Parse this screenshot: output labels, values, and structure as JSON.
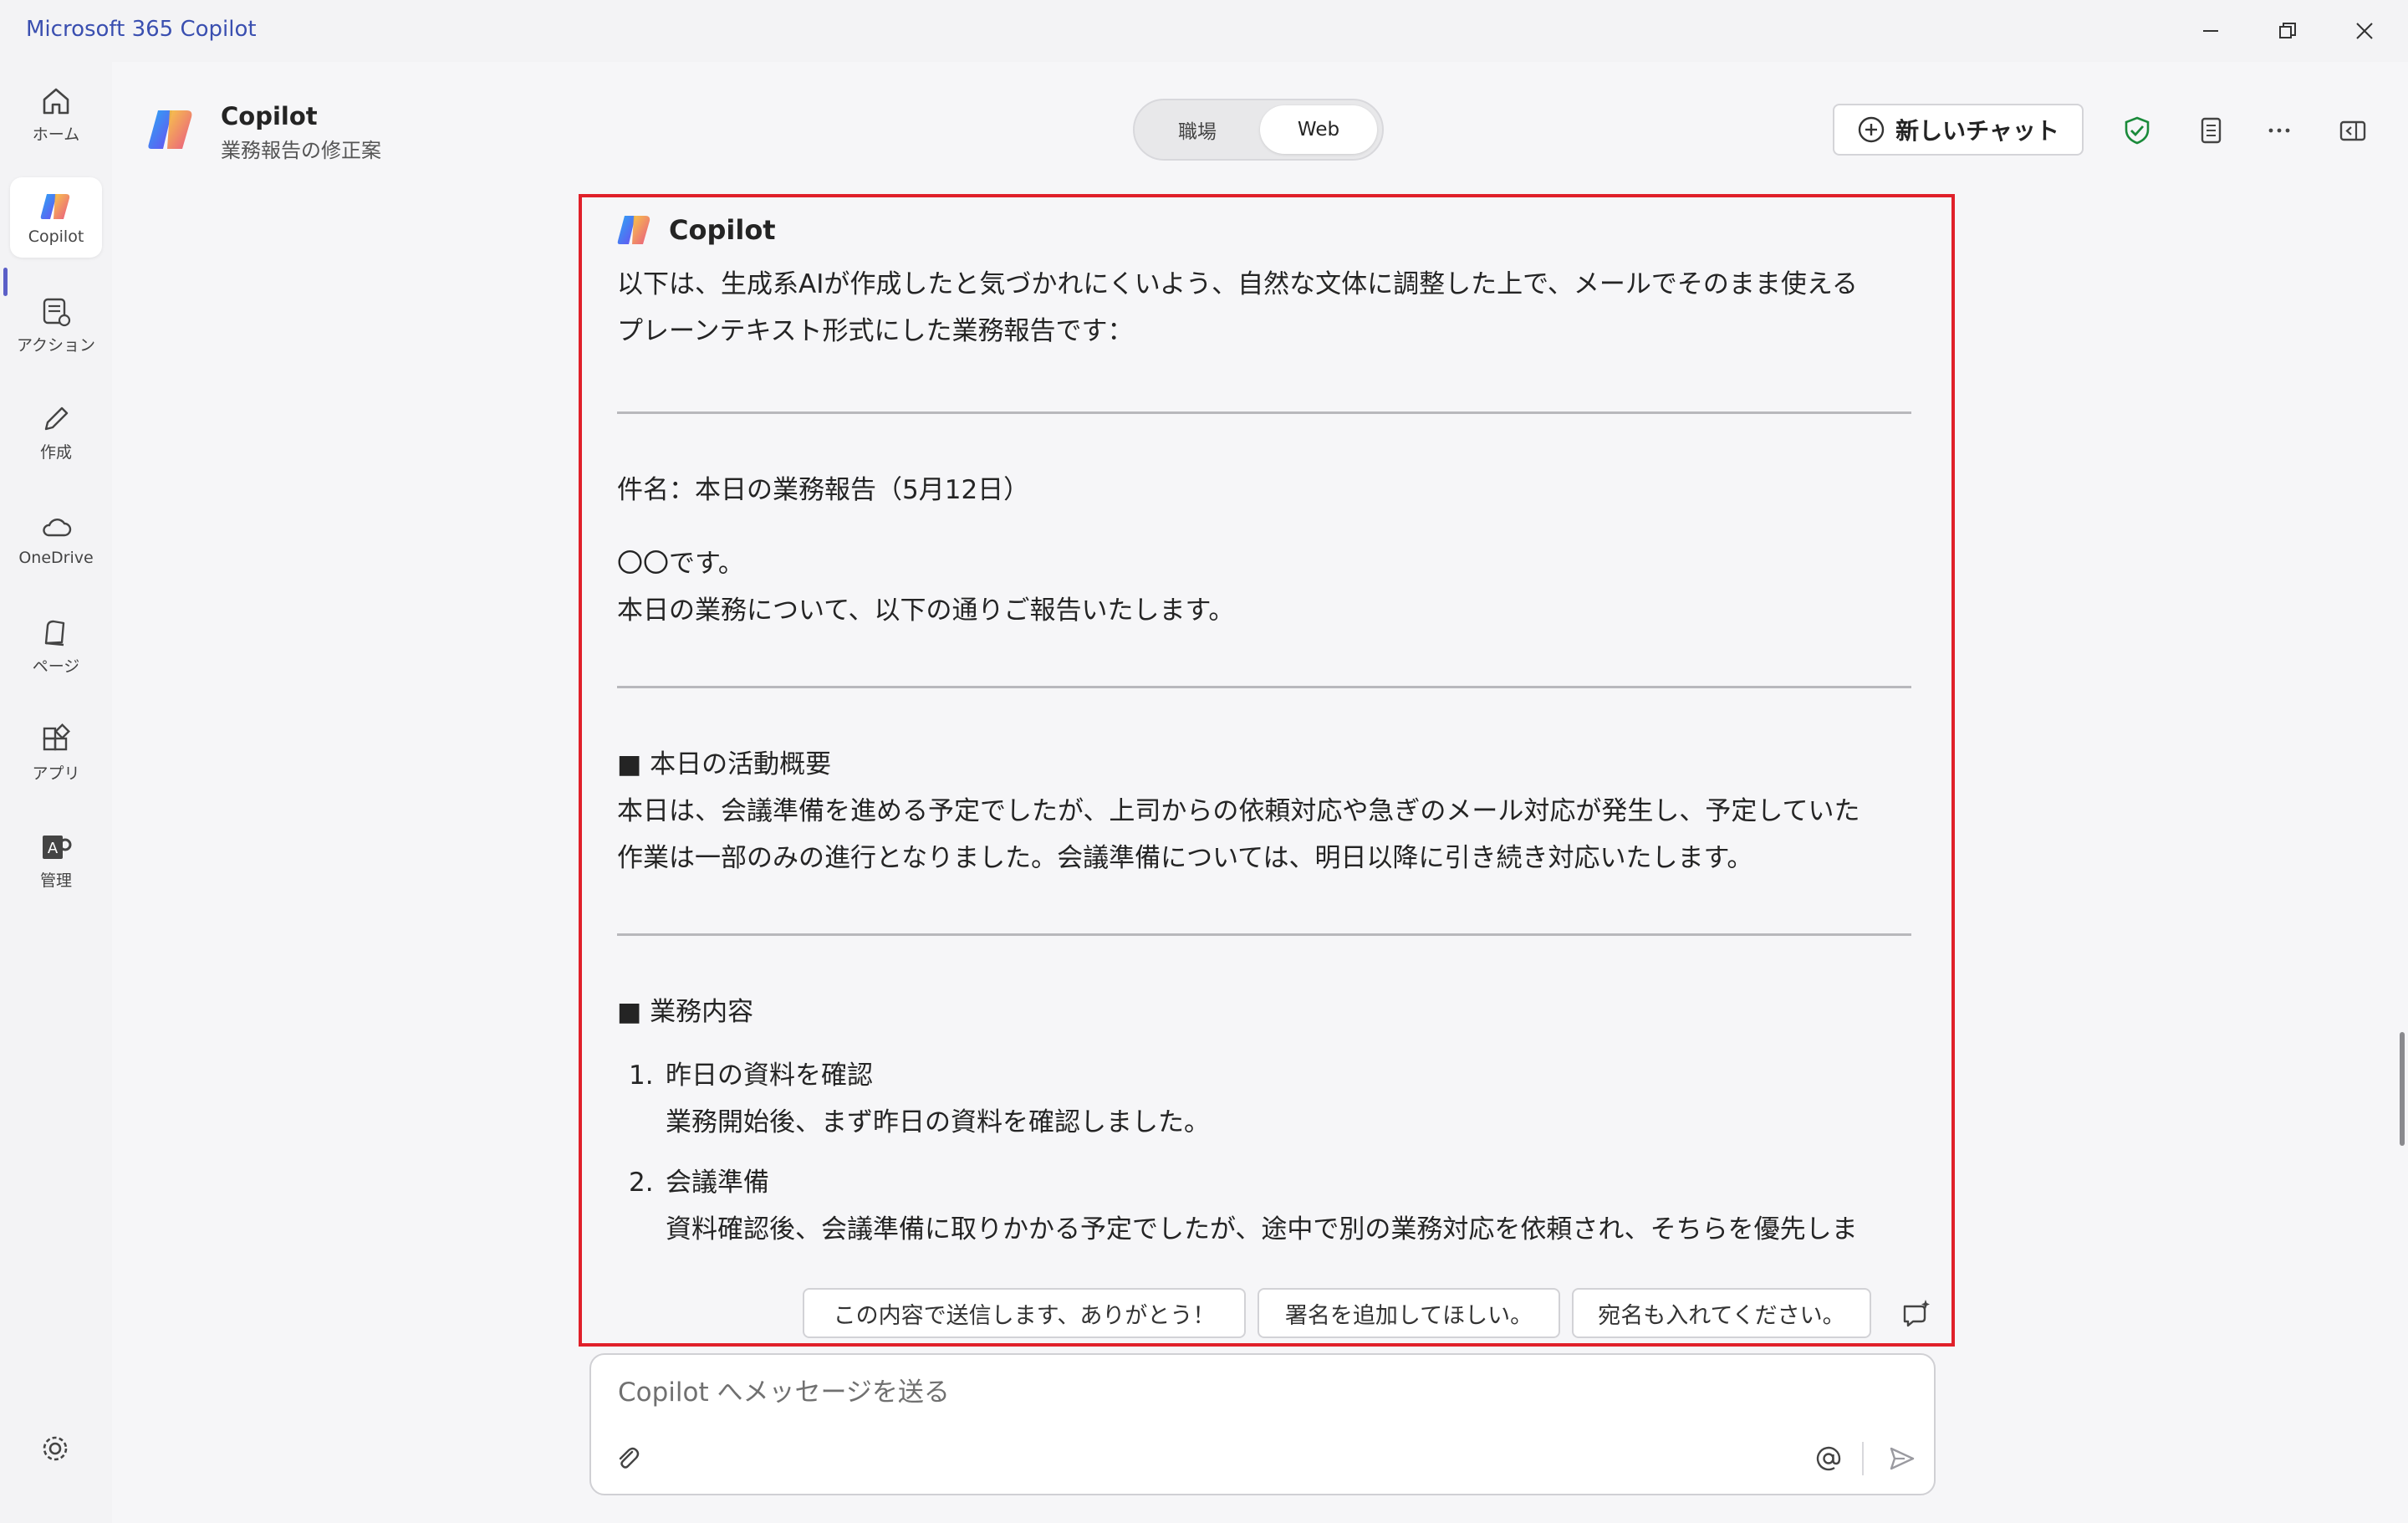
{
  "app": {
    "title": "Microsoft 365 Copilot"
  },
  "colors": {
    "accent": "#5b5fc7",
    "highlight": "#e0202a",
    "shield": "#1a8a3a"
  },
  "rail": {
    "items": [
      {
        "label": "ホーム",
        "icon": "home-icon"
      },
      {
        "label": "Copilot",
        "icon": "copilot-logo-icon"
      },
      {
        "label": "アクション",
        "icon": "actions-icon"
      },
      {
        "label": "作成",
        "icon": "pencil-icon"
      },
      {
        "label": "OneDrive",
        "icon": "cloud-icon"
      },
      {
        "label": "ページ",
        "icon": "pages-icon"
      },
      {
        "label": "アプリ",
        "icon": "apps-icon"
      },
      {
        "label": "管理",
        "icon": "admin-icon"
      }
    ],
    "settings_icon": "gear-icon"
  },
  "header": {
    "chat_title": "Copilot",
    "chat_subtitle": "業務報告の修正案",
    "toggle": {
      "left": "職場",
      "right": "Web",
      "selected": "Web"
    },
    "new_chat_label": "新しいチャット"
  },
  "response": {
    "author": "Copilot",
    "intro_line1": "以下は、生成系AIが作成したと気づかれにくいよう、自然な文体に調整した上で、メールでそのまま使える",
    "intro_line2": "プレーンテキスト形式にした業務報告です：",
    "subject": "件名：本日の業務報告（5月12日）",
    "greeting1": "〇〇です。",
    "greeting2": "本日の業務について、以下の通りご報告いたします。",
    "summary_heading": "■ 本日の活動概要",
    "summary_line1": "本日は、会議準備を進める予定でしたが、上司からの依頼対応や急ぎのメール対応が発生し、予定していた",
    "summary_line2": "作業は一部のみの進行となりました。会議準備については、明日以降に引き続き対応いたします。",
    "tasks_heading": "■ 業務内容",
    "tasks": [
      {
        "num": "1.",
        "title": "昨日の資料を確認",
        "body": "業務開始後、まず昨日の資料を確認しました。"
      },
      {
        "num": "2.",
        "title": "会議準備",
        "body": "資料確認後、会議準備に取りかかる予定でしたが、途中で別の業務対応を依頼され、そちらを優先しま"
      }
    ],
    "suggestions": [
      "この内容で送信します、ありがとう！",
      "署名を追加してほしい。",
      "宛名も入れてください。"
    ]
  },
  "composer": {
    "placeholder": "Copilot へメッセージを送る"
  }
}
